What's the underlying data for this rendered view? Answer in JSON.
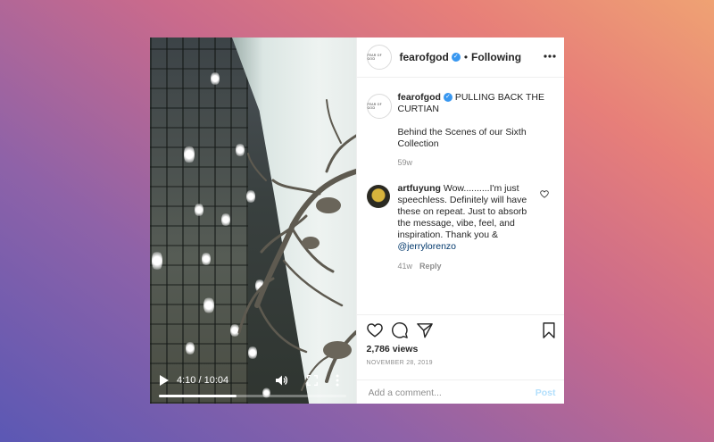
{
  "video": {
    "time_display": "4:10 / 10:04",
    "progress_fraction": 0.413
  },
  "header": {
    "avatar_text": "FEAR OF GOD",
    "username": "fearofgod",
    "verified_mark": "✓",
    "separator": "•",
    "follow_label": "Following"
  },
  "caption": {
    "username": "fearofgod",
    "title": "PULLING BACK THE CURTIAN",
    "body": "Behind the Scenes of our Sixth Collection",
    "time": "59w"
  },
  "comment": {
    "username": "artfuyung",
    "text": "Wow..........I'm just speechless. Definitely will have these on repeat. Just to absorb the message, vibe, feel, and inspiration. Thank you &",
    "mention": "@jerrylorenzo",
    "time": "41w",
    "reply_label": "Reply"
  },
  "stats": {
    "views": "2,786 views",
    "date": "NOVEMBER 28, 2019"
  },
  "add_comment": {
    "placeholder": "Add a comment...",
    "post_label": "Post"
  },
  "colors": {
    "verified": "#3897f0",
    "post_button": "#b2dffc",
    "mention": "#00376b"
  },
  "icons": [
    "play-icon",
    "volume-icon",
    "fullscreen-icon",
    "more-vertical-icon",
    "more-horizontal-icon",
    "heart-icon",
    "comment-icon",
    "share-icon",
    "bookmark-icon"
  ]
}
